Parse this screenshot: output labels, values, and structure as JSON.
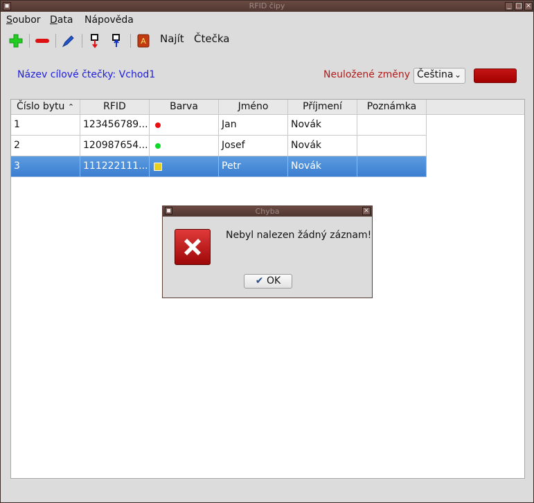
{
  "window": {
    "title": "RFID čipy"
  },
  "menu": {
    "soubor_first": "S",
    "soubor_rest": "oubor",
    "data_first": "D",
    "data_rest": "ata",
    "napoveda": "Nápověda"
  },
  "toolbar": {
    "find_label": "Najít",
    "reader_label": "Čtečka"
  },
  "header": {
    "reader_name_label": "Název cílové čtečky: Vchod1",
    "unsaved_changes": "Neuložené změny",
    "language": "Čeština"
  },
  "table": {
    "columns": [
      "Číslo bytu",
      "RFID",
      "Barva",
      "Jméno",
      "Příjmení",
      "Poznámka"
    ],
    "rows": [
      {
        "apartment": "1",
        "rfid": "123456789...",
        "color": "#e81010",
        "first_name": "Jan",
        "last_name": "Novák",
        "note": ""
      },
      {
        "apartment": "2",
        "rfid": "120987654...",
        "color": "#10d82a",
        "first_name": "Josef",
        "last_name": "Novák",
        "note": ""
      },
      {
        "apartment": "3",
        "rfid": "111222111...",
        "color": "#e8d020",
        "first_name": "Petr",
        "last_name": "Novák",
        "note": ""
      }
    ]
  },
  "dialog": {
    "title": "Chyba",
    "message": "Nebyl nalezen žádný záznam!",
    "ok_label": "OK"
  },
  "colors": {
    "accent_red": "#b11a1a",
    "link_blue": "#1c1ce0",
    "selection": "#3c7fd0"
  }
}
